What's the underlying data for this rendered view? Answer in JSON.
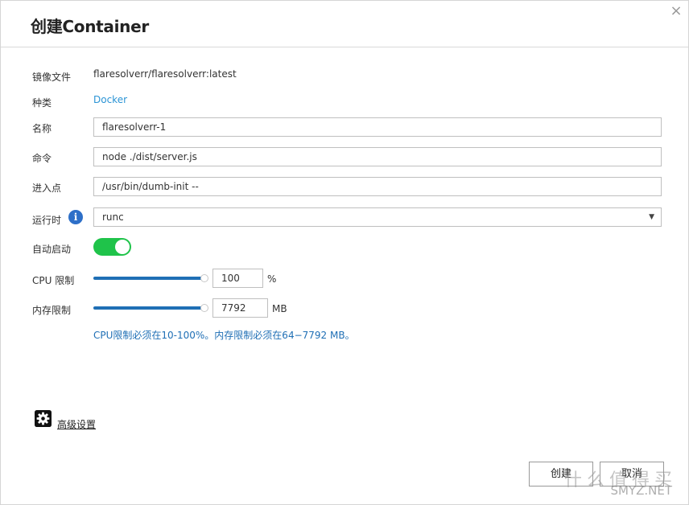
{
  "dialog": {
    "title": "创建Container",
    "close_icon": "close-icon"
  },
  "form": {
    "image": {
      "label": "镜像文件",
      "value": "flaresolverr/flaresolverr:latest"
    },
    "type": {
      "label": "种类",
      "value": "Docker"
    },
    "name": {
      "label": "名称",
      "value": "flaresolverr-1"
    },
    "command": {
      "label": "命令",
      "value": "node ./dist/server.js"
    },
    "entrypoint": {
      "label": "进入点",
      "value": "/usr/bin/dumb-init --"
    },
    "runtime": {
      "label": "运行时",
      "value": "runc",
      "icon": "info-icon"
    },
    "autostart": {
      "label": "自动启动",
      "enabled": true
    },
    "cpu": {
      "label": "CPU 限制",
      "value": "100",
      "unit": "%",
      "fraction": 1.0
    },
    "memory": {
      "label": "内存限制",
      "value": "7792",
      "unit": "MB",
      "fraction": 1.0
    },
    "hint": "CPU限制必须在10-100%。内存限制必须在64−7792 MB。"
  },
  "advanced": {
    "label": "高级设置",
    "icon": "gear-icon"
  },
  "buttons": {
    "create": "创建",
    "cancel": "取消"
  },
  "watermark": {
    "line1": "什么值得买",
    "line2": "SMYZ.NET"
  },
  "colors": {
    "accent": "#2b94d5",
    "toggle_on": "#1fc34a",
    "slider": "#1f6fb5",
    "hint": "#1f6fb5"
  }
}
